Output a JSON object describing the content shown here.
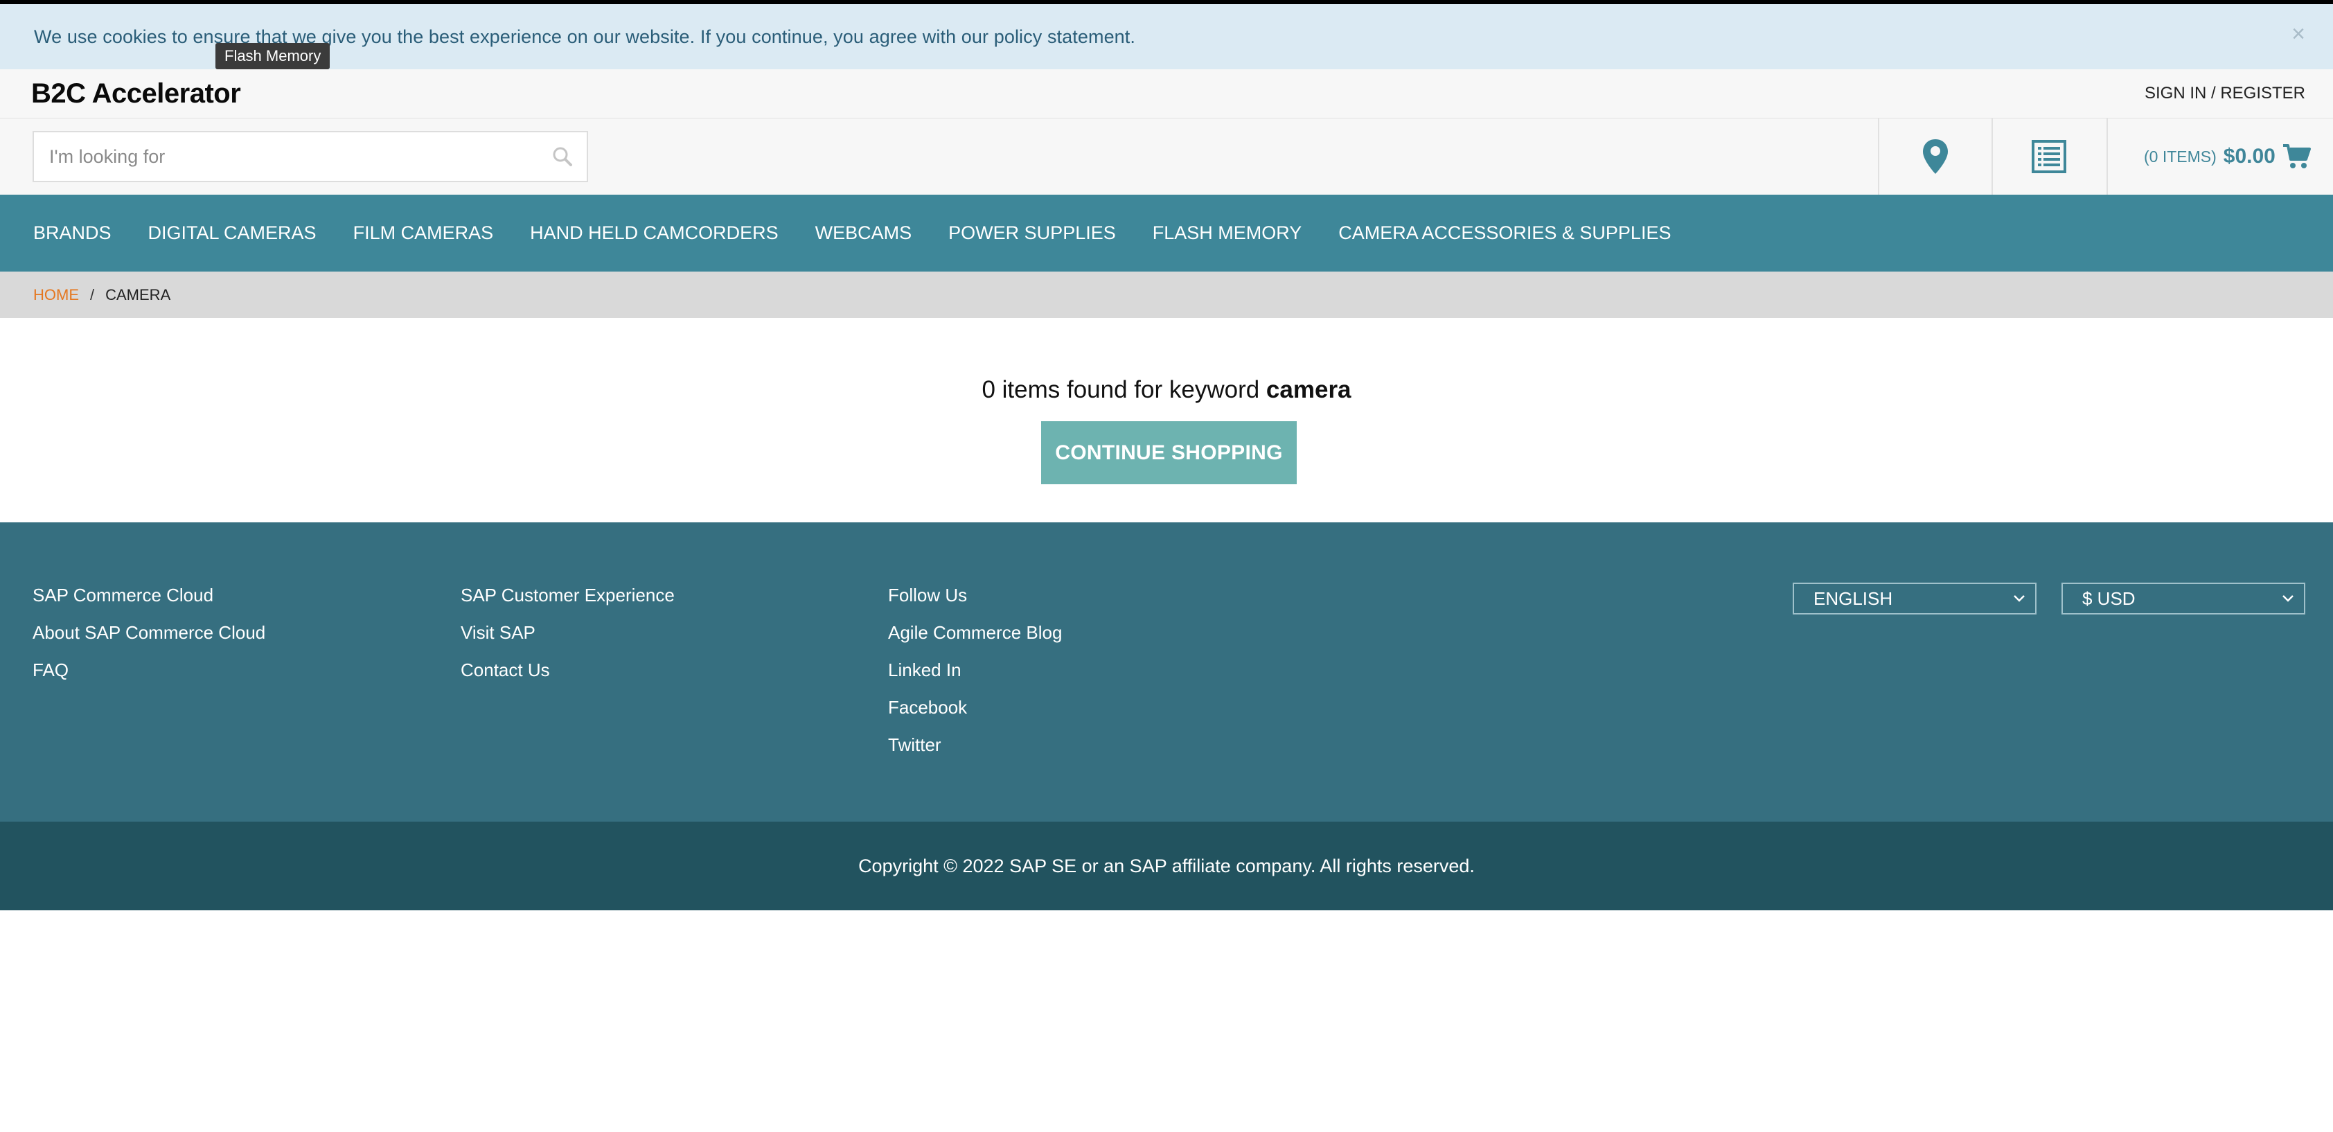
{
  "cookie_banner": {
    "text": "We use cookies to ensure that we give you the best experience on our website. If you continue, you agree with our policy statement.",
    "close_glyph": "×"
  },
  "tooltip": {
    "text": "Flash Memory"
  },
  "header": {
    "logo": "B2C Accelerator",
    "signin": "SIGN IN / REGISTER"
  },
  "search": {
    "placeholder": "I'm looking for",
    "value": ""
  },
  "icons": {
    "search": "search-icon",
    "store": "map-pin-icon",
    "list": "list-icon",
    "cart": "cart-icon"
  },
  "cart": {
    "count_label": "(0 ITEMS)",
    "total": "$0.00"
  },
  "nav": {
    "items": [
      "BRANDS",
      "DIGITAL CAMERAS",
      "FILM CAMERAS",
      "HAND HELD CAMCORDERS",
      "WEBCAMS",
      "POWER SUPPLIES",
      "FLASH MEMORY",
      "CAMERA ACCESSORIES & SUPPLIES"
    ]
  },
  "breadcrumb": {
    "home": "HOME",
    "separator": "/",
    "current": "CAMERA"
  },
  "results": {
    "prefix": "0 items found for keyword ",
    "keyword": "camera",
    "continue_label": "CONTINUE SHOPPING"
  },
  "footer": {
    "col1": [
      "SAP Commerce Cloud",
      "About SAP Commerce Cloud",
      "FAQ"
    ],
    "col2": [
      "SAP Customer Experience",
      "Visit SAP",
      "Contact Us"
    ],
    "col3": [
      "Follow Us",
      "Agile Commerce Blog",
      "Linked In",
      "Facebook",
      "Twitter"
    ],
    "language": "ENGLISH",
    "currency": "$ USD",
    "copyright": "Copyright © 2022 SAP SE or an SAP affiliate company. All rights reserved."
  },
  "colors": {
    "nav_bg": "#3e8799",
    "footer_bg": "#366f80",
    "copyright_bg": "#22535f",
    "accent_orange": "#e5771f",
    "button_teal": "#6db3b0",
    "cookie_bg": "#dbeaf3"
  }
}
